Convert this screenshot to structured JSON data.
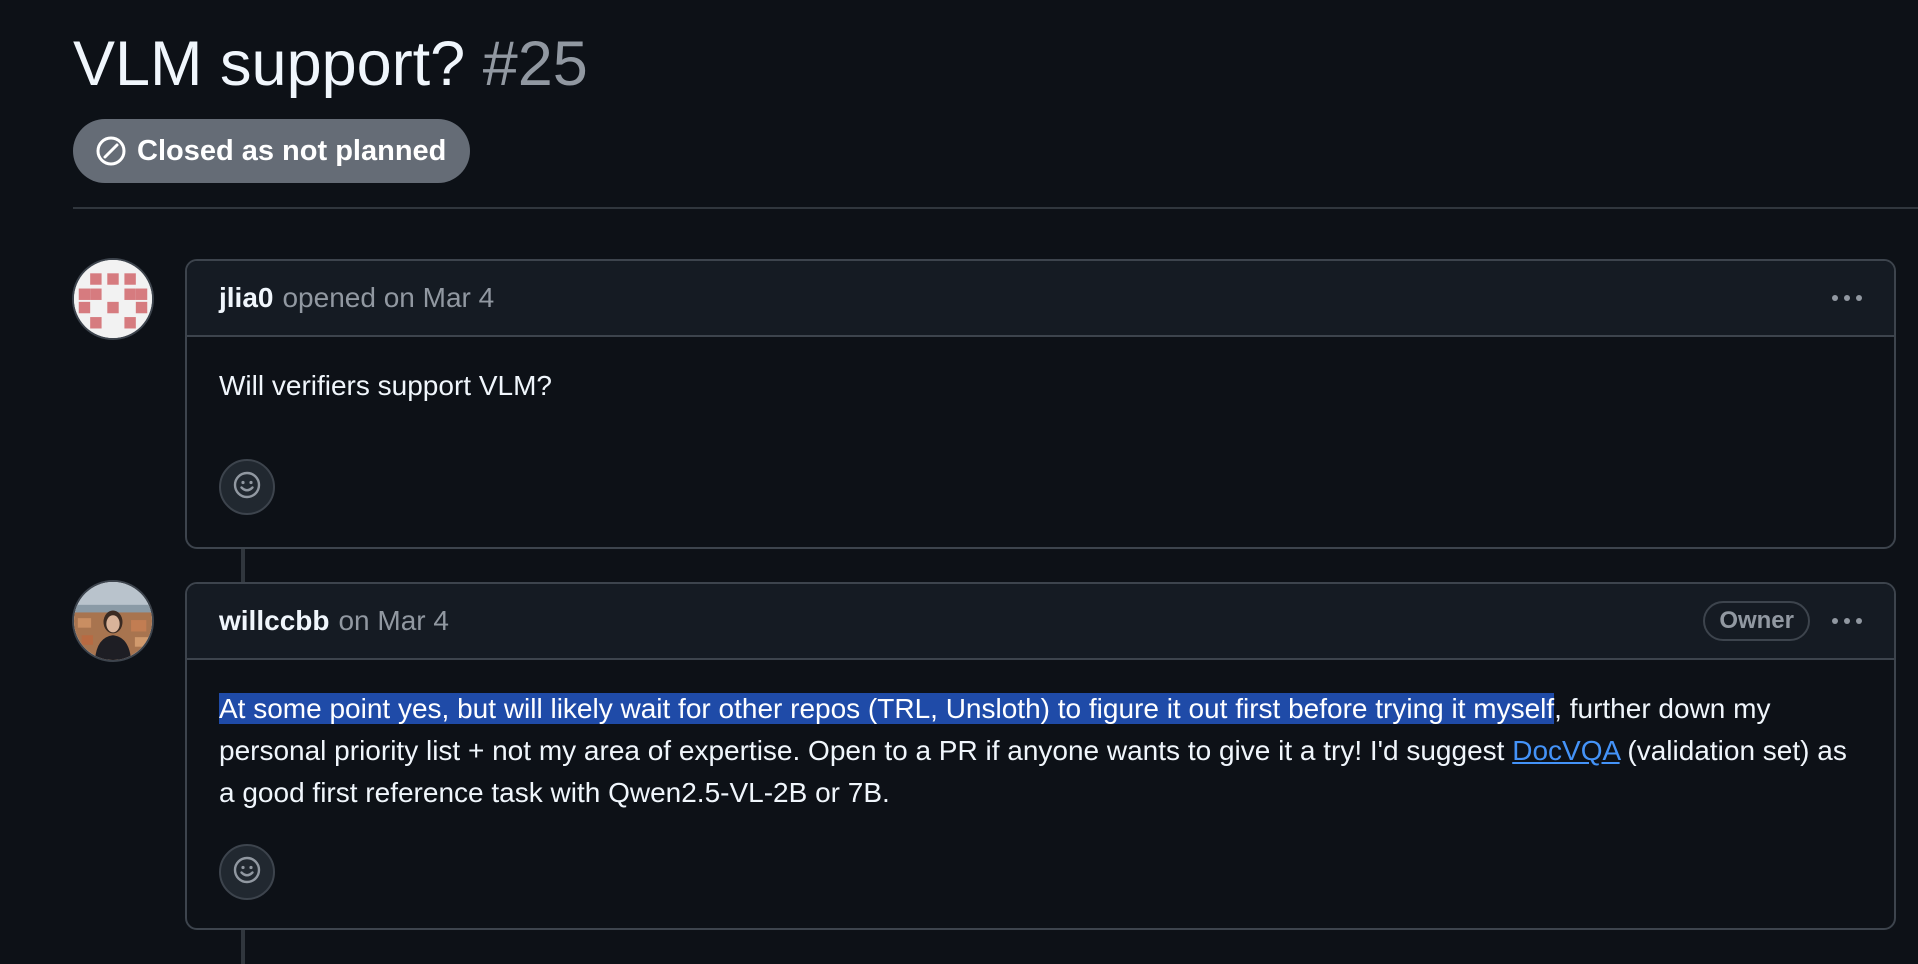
{
  "issue": {
    "title": "VLM support?",
    "number": "#25",
    "state": {
      "label": "Closed as not planned",
      "icon": "skip-circle-icon",
      "color": "#656c76"
    }
  },
  "comments": [
    {
      "author": "jlia0",
      "meta": "opened on Mar 4",
      "badge": null,
      "avatar": "identicon-avatar",
      "body": {
        "text": "Will verifiers support VLM?"
      }
    },
    {
      "author": "willccbb",
      "meta": "on Mar 4",
      "badge": "Owner",
      "avatar": "photo-avatar",
      "body": {
        "selected": "At some point yes, but will likely wait for other repos (TRL, Unsloth) to figure it out first before trying it myself",
        "before_link": ", further down my personal priority list + not my area of expertise. Open to a PR if anyone wants to give it a try! I'd suggest ",
        "link": "DocVQA",
        "after_link": " (validation set) as a good first reference task with Qwen2.5-VL-2B or 7B."
      }
    }
  ],
  "colors": {
    "background": "#0d1117",
    "header_bg": "#151b23",
    "border": "#3d444d",
    "muted_text": "#9198a1",
    "link": "#4493f8",
    "selection": "#1f4ba8"
  }
}
